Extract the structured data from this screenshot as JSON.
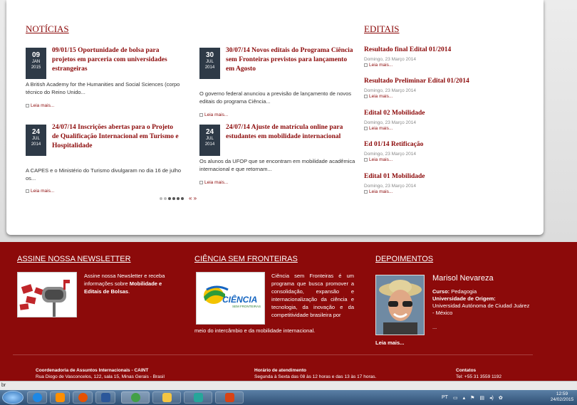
{
  "news": {
    "heading": "NOTÍCIAS",
    "items": [
      {
        "day": "09",
        "month": "JAN",
        "year": "2015",
        "title": "09/01/15 Oportunidade de bolsa para projetos em parceria com universidades estrangeiras",
        "excerpt": "A British Academy for the Humanities and Social Sciences (corpo técnico do Reino Unido...",
        "more": "Leia mais..."
      },
      {
        "day": "30",
        "month": "JUL",
        "year": "2014",
        "title": "30/07/14 Novos editais do Programa Ciência sem Fronteiras previstos para lançamento em Agosto",
        "excerpt": "O governo federal anunciou a previsão de lançamento de novos editais do programa Ciência...",
        "more": "Leia mais..."
      },
      {
        "day": "24",
        "month": "JUL",
        "year": "2014",
        "title": "24/07/14 Inscrições abertas para o Projeto de Qualificação Internacional em Turismo e Hospitalidade",
        "excerpt": "A CAPES e o Ministério do Turismo divulgaram no dia 16 de julho os...",
        "more": "Leia mais..."
      },
      {
        "day": "24",
        "month": "JUL",
        "year": "2014",
        "title": "24/07/14 Ajuste de matrícula online para estudantes em mobilidade internacional",
        "excerpt": "Os alunos da UFOP que se encontram em mobilidade acadêmica internacional e que retornam...",
        "more": "Leia mais..."
      }
    ],
    "pager_arrows": "« »"
  },
  "editais": {
    "heading": "EDITAIS",
    "items": [
      {
        "title": "Resultado final Edital 01/2014",
        "date": "Domingo, 23 Março 2014",
        "more": "Leia mais..."
      },
      {
        "title": "Resultado Preliminar Edital 01/2014",
        "date": "Domingo, 23 Março 2014",
        "more": "Leia mais..."
      },
      {
        "title": "Edital 02 Mobilidade",
        "date": "Domingo, 23 Março 2014",
        "more": "Leia mais..."
      },
      {
        "title": "Ed 01/14 Retificação",
        "date": "Domingo, 23 Março 2014",
        "more": "Leia mais..."
      },
      {
        "title": "Edital 01 Mobilidade",
        "date": "Domingo, 23 Março 2014",
        "more": "Leia mais..."
      }
    ]
  },
  "newsletter": {
    "heading": "ASSINE NOSSA NEWSLETTER",
    "text_before": "Assine nossa Newsletter e receba informações sobre ",
    "text_bold": "Mobilidade e Editais de Bolsas",
    "text_after": "."
  },
  "csf": {
    "heading": "CIÊNCIA SEM FRONTEIRAS",
    "logo_text": "CIÊNCIA",
    "logo_sub": "SEM FRONTEIRAS",
    "text_side": "Ciência sem Fronteiras é um programa que busca promover a consolidação, expansão e internacionalização da ciência e tecnologia, da inovação e da competitividade brasileira por",
    "text_full": "meio do intercâmbio e da mobilidade internacional."
  },
  "depoimentos": {
    "heading": "DEPOIMENTOS",
    "name": "Marisol Nevareza",
    "course_label": "Curso:",
    "course": " Pedagogia",
    "uni_label": "Universidade de Origem:",
    "uni": "Universidad Autónoma de Ciudad Juárez - México",
    "ellipsis": "...",
    "more": "Leia mais..."
  },
  "footer": {
    "col1_title": "Coordenadoria de Assuntos Internacionais - CAINT",
    "col1_text": "Rua Diogo de Vasconcelos, 122, sala 15, Minas Gerais - Brasil",
    "col2_title": "Horário de atendimento",
    "col2_text": "Segunda à Sexta das 08 às 12 horas  e das 13 às 17 horas.",
    "col3_title": "Contatos",
    "col3_text": "Tel: +55 31 3559 1192"
  },
  "status_bar": "br",
  "taskbar": {
    "lang": "PT",
    "time": "12:59",
    "date": "24/02/2015",
    "colors": {
      "ie": "#1e88e5",
      "media": "#ff8f00",
      "firefox": "#e65100",
      "word": "#2b579a",
      "chrome": "#43a047",
      "explorer": "#f4c542",
      "paint": "#26a69a",
      "powerpoint": "#d84315"
    }
  }
}
